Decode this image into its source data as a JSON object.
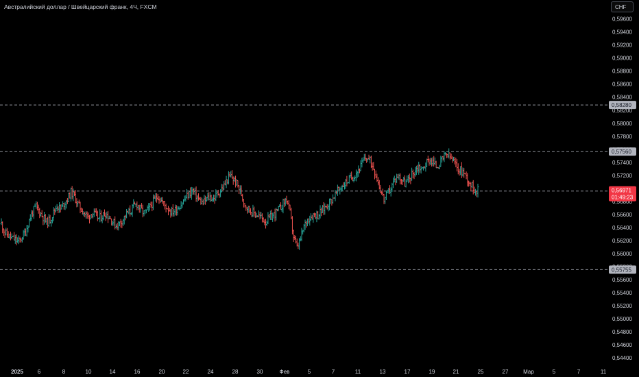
{
  "header": {
    "title": "Австралийский доллар / Швейцарский франк, 4Ч, FXCM",
    "currency_label": "CHF"
  },
  "colors": {
    "background": "#000000",
    "up": "#26a69a",
    "down": "#ef5350",
    "text": "#d1d4dc",
    "level_line": "#9598a1",
    "level_label_bg": "#b2b5be",
    "price_label_bg": "#f23645"
  },
  "chart_data": {
    "type": "candlestick",
    "title": "Австралийский доллар / Швейцарский франк, 4Ч, FXCM",
    "y_axis": {
      "min": 0.5436,
      "max": 0.5968,
      "ticks": [
        "0,59600",
        "0,59400",
        "0,59200",
        "0,59000",
        "0,58800",
        "0,58600",
        "0,58400",
        "0,58200",
        "0,58000",
        "0,57800",
        "0,57600",
        "0,57400",
        "0,57200",
        "0,57000",
        "0,56800",
        "0,56600",
        "0,56400",
        "0,56200",
        "0,56000",
        "0,55800",
        "0,55600",
        "0,55400",
        "0,55200",
        "0,55000",
        "0,54800",
        "0,54600",
        "0,54400"
      ]
    },
    "x_axis": {
      "ticks": [
        {
          "label": "2025",
          "bold": true
        },
        {
          "label": "6"
        },
        {
          "label": "8"
        },
        {
          "label": "10"
        },
        {
          "label": "14"
        },
        {
          "label": "16"
        },
        {
          "label": "20"
        },
        {
          "label": "22"
        },
        {
          "label": "24"
        },
        {
          "label": "28"
        },
        {
          "label": "30"
        },
        {
          "label": "Фев"
        },
        {
          "label": "5"
        },
        {
          "label": "7"
        },
        {
          "label": "11"
        },
        {
          "label": "13"
        },
        {
          "label": "17"
        },
        {
          "label": "19"
        },
        {
          "label": "21"
        },
        {
          "label": "25"
        },
        {
          "label": "27"
        },
        {
          "label": "Мар"
        },
        {
          "label": "5"
        },
        {
          "label": "7"
        },
        {
          "label": "11"
        }
      ]
    },
    "horizontal_levels": [
      {
        "price": 0.5828,
        "label": "0,58280"
      },
      {
        "price": 0.57565,
        "label": "0,57560"
      },
      {
        "price": 0.5696,
        "label": "0,56960"
      },
      {
        "price": 0.55755,
        "label": "0,55755"
      }
    ],
    "current_price": {
      "value": 0.56971,
      "label": "0,56971",
      "countdown": "01:49:23"
    },
    "price_path": [
      0.5646,
      0.5632,
      0.5628,
      0.5624,
      0.5621,
      0.5618,
      0.5626,
      0.5634,
      0.5652,
      0.5664,
      0.5672,
      0.5664,
      0.5656,
      0.5648,
      0.5652,
      0.5663,
      0.5674,
      0.5668,
      0.5677,
      0.5684,
      0.5694,
      0.5688,
      0.5676,
      0.5668,
      0.5661,
      0.5656,
      0.5663,
      0.5659,
      0.5654,
      0.5658,
      0.5662,
      0.5656,
      0.5649,
      0.5643,
      0.5647,
      0.5653,
      0.5661,
      0.5664,
      0.5672,
      0.5676,
      0.5668,
      0.5662,
      0.5666,
      0.5674,
      0.5682,
      0.5689,
      0.5681,
      0.5674,
      0.5669,
      0.5664,
      0.5667,
      0.5672,
      0.5678,
      0.5686,
      0.5692,
      0.5697,
      0.5689,
      0.5681,
      0.5677,
      0.5684,
      0.5687,
      0.5684,
      0.5691,
      0.5697,
      0.5704,
      0.5714,
      0.5719,
      0.5712,
      0.5704,
      0.5691,
      0.5676,
      0.5669,
      0.5664,
      0.5661,
      0.5658,
      0.5654,
      0.5649,
      0.5654,
      0.5658,
      0.5663,
      0.5669,
      0.5677,
      0.5684,
      0.5662,
      0.5626,
      0.5609,
      0.5622,
      0.5641,
      0.5653,
      0.5657,
      0.5661,
      0.5659,
      0.5665,
      0.5671,
      0.5677,
      0.5683,
      0.5691,
      0.5698,
      0.5704,
      0.5709,
      0.5714,
      0.5718,
      0.5724,
      0.5731,
      0.5741,
      0.5748,
      0.5742,
      0.5732,
      0.5716,
      0.5698,
      0.5683,
      0.5691,
      0.5701,
      0.5712,
      0.5719,
      0.5715,
      0.5708,
      0.5712,
      0.5721,
      0.5728,
      0.5734,
      0.5729,
      0.5738,
      0.5744,
      0.5741,
      0.5734,
      0.5738,
      0.5746,
      0.5752,
      0.5748,
      0.5741,
      0.5732,
      0.5728,
      0.5724,
      0.5715,
      0.5706,
      0.5699,
      0.5697
    ]
  }
}
